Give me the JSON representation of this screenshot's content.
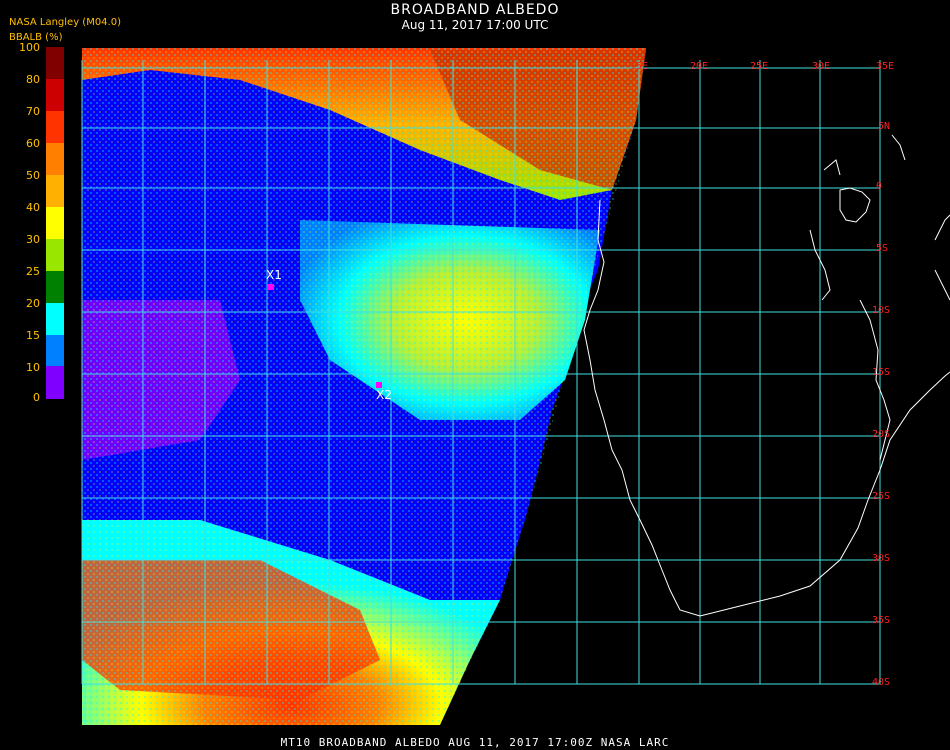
{
  "title": "BROADBAND ALBEDO",
  "subtitle": "Aug 11, 2017 17:00 UTC",
  "source": "NASA Langley (M04.0)",
  "colorbar": {
    "unit_label": "BBALB (%)",
    "ticks": [
      "100",
      "80",
      "70",
      "60",
      "50",
      "40",
      "30",
      "25",
      "20",
      "15",
      "10",
      "0"
    ],
    "colors": [
      "#800000",
      "#cc0000",
      "#ff3300",
      "#ff8000",
      "#ffb000",
      "#ffff00",
      "#99e600",
      "#008000",
      "#00ffff",
      "#0080ff",
      "#0000ff",
      "#8000ff"
    ]
  },
  "lon_labels": [
    "15E",
    "20E",
    "25E",
    "30E",
    "35E"
  ],
  "lat_labels": [
    "5N",
    "0",
    "5S",
    "10S",
    "15S",
    "20S",
    "25S",
    "30S",
    "35S",
    "40S"
  ],
  "markers": [
    {
      "label": "X1",
      "color": "#ff00ff"
    },
    {
      "label": "X2",
      "color": "#ff00ff"
    }
  ],
  "footer": "MT10  BROADBAND ALBEDO   AUG 11, 2017 17:00Z   NASA LARC"
}
